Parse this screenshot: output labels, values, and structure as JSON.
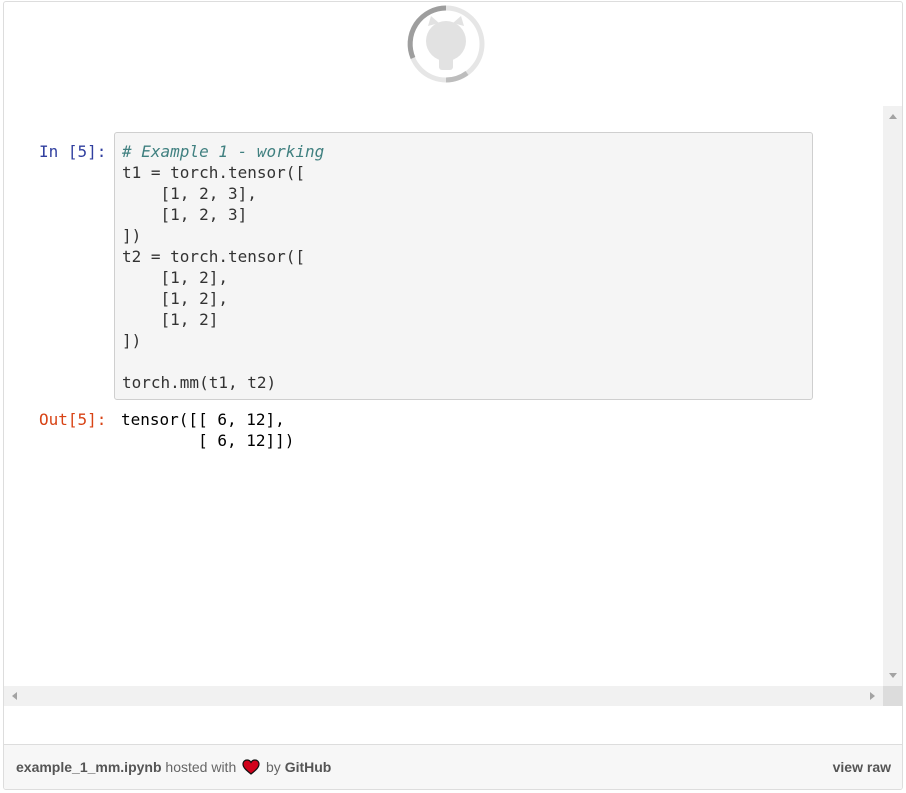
{
  "gist": {
    "filename": "example_1_mm.ipynb",
    "hosted_with": "hosted with",
    "by": "by",
    "host": "GitHub",
    "view_raw": "view raw",
    "heart_color": "#d0021b"
  },
  "cell": {
    "in_prompt": "In [5]:",
    "out_prompt": "Out[5]:",
    "code_comment": "# Example 1 - working",
    "code_body": "t1 = torch.tensor([\n    [1, 2, 3],\n    [1, 2, 3]\n])\nt2 = torch.tensor([\n    [1, 2],\n    [1, 2],\n    [1, 2]\n])\n\ntorch.mm(t1, t2)",
    "output": "tensor([[ 6, 12],\n        [ 6, 12]])"
  },
  "colors": {
    "in_prompt": "#303f9f",
    "out_prompt": "#d84315",
    "comment": "#408080",
    "cell_background": "#f5f5f5"
  },
  "icons": {
    "loader": "github-octocat-loading-icon"
  }
}
